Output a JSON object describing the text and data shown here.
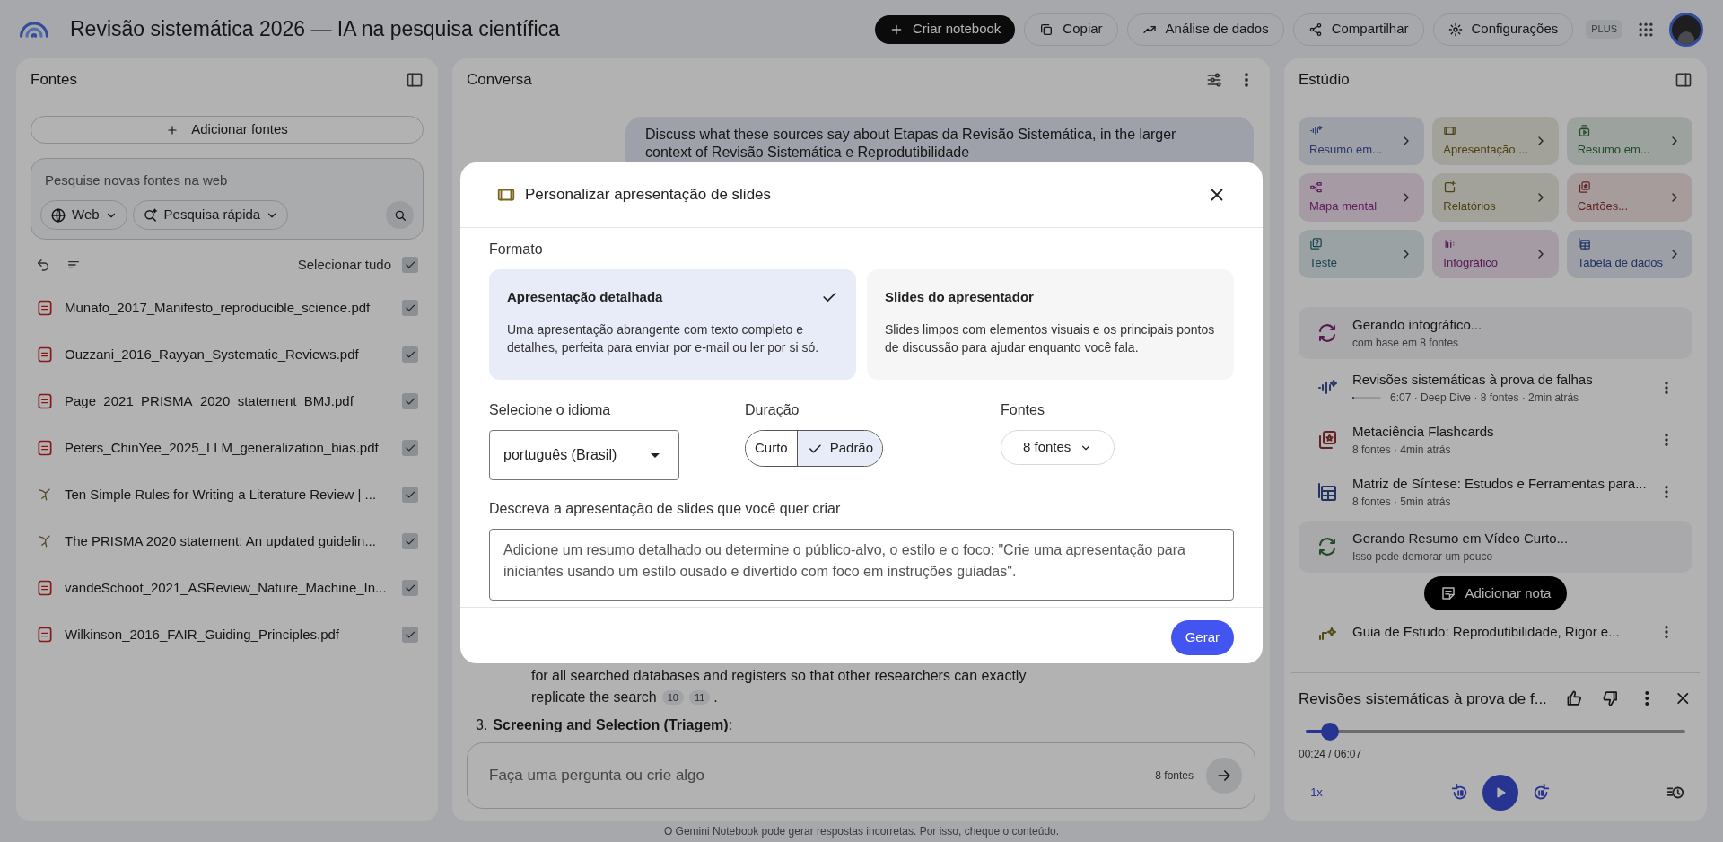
{
  "app": {
    "title": "Revisão sistemática 2026 — IA na pesquisa científica",
    "plan_badge": "PLUS"
  },
  "header_actions": [
    {
      "label": "Criar notebook",
      "kind": "primary"
    },
    {
      "label": "Copiar",
      "kind": "copy"
    },
    {
      "label": "Análise de dados",
      "kind": "analytics"
    },
    {
      "label": "Compartilhar",
      "kind": "share"
    },
    {
      "label": "Configurações",
      "kind": "settings"
    }
  ],
  "sources_panel": {
    "title": "Fontes",
    "add_button": "Adicionar fontes",
    "search": {
      "placeholder": "Pesquise novas fontes na web",
      "source_chip": "Web",
      "mode_chip": "Pesquisa rápida"
    },
    "select_all": {
      "label": "Selecionar tudo",
      "checked": true
    },
    "items": [
      {
        "name": "Munafo_2017_Manifesto_reproducible_science.pdf",
        "kind": "pdf",
        "checked": true
      },
      {
        "name": "Ouzzani_2016_Rayyan_Systematic_Reviews.pdf",
        "kind": "pdf",
        "checked": true
      },
      {
        "name": "Page_2021_PRISMA_2020_statement_BMJ.pdf",
        "kind": "pdf",
        "checked": true
      },
      {
        "name": "Peters_ChinYee_2025_LLM_generalization_bias.pdf",
        "kind": "pdf",
        "checked": true
      },
      {
        "name": "Ten Simple Rules for Writing a Literature Review | ...",
        "kind": "web",
        "checked": true
      },
      {
        "name": "The PRISMA 2020 statement: An updated guidelin...",
        "kind": "web",
        "checked": true
      },
      {
        "name": "vandeSchoot_2021_ASReview_Nature_Machine_In...",
        "kind": "pdf",
        "checked": true
      },
      {
        "name": "Wilkinson_2016_FAIR_Guiding_Principles.pdf",
        "kind": "pdf",
        "checked": true
      }
    ]
  },
  "chat_panel": {
    "title": "Conversa",
    "user_message": [
      "Discuss what these sources say about Etapas da Revisão Sistemática, in the larger",
      "context of Revisão Sistemática e Reprodutibilidade"
    ],
    "response_lines": [
      {
        "text": "for all searched databases and registers so that other researchers can exactly"
      },
      {
        "text": "replicate the search",
        "citations": [
          "10",
          "11"
        ],
        "tail": "."
      }
    ],
    "list_item": {
      "number": "3.",
      "text": "**Screening and Selection (Triagem)**:"
    },
    "input": {
      "placeholder": "Faça uma pergunta ou crie algo",
      "source_count": "8 fontes"
    }
  },
  "studio_panel": {
    "title": "Estúdio",
    "tiles": [
      {
        "label": "Resumo em...",
        "kind": "audio"
      },
      {
        "label": "Apresentação ...",
        "kind": "slides"
      },
      {
        "label": "Resumo em...",
        "kind": "video"
      },
      {
        "label": "Mapa mental",
        "kind": "mindmap"
      },
      {
        "label": "Relatórios",
        "kind": "reports"
      },
      {
        "label": "Cartões...",
        "kind": "flashcards"
      },
      {
        "label": "Teste",
        "kind": "quiz"
      },
      {
        "label": "Infográfico",
        "kind": "infographic"
      },
      {
        "label": "Tabela de dados",
        "kind": "table"
      }
    ],
    "items": [
      {
        "kind": "infographic_job",
        "title": "Gerando infográfico...",
        "subtitle": "com base em 8 fontes"
      },
      {
        "kind": "audio",
        "title": "Revisões sistemáticas à prova de falhas",
        "subtitle": "6:07 · Deep Dive · 8 fontes · 2min atrás",
        "level": 0.06
      },
      {
        "kind": "flashcards",
        "title": "Metaciência Flashcards",
        "subtitle": "8 fontes · 4min atrás"
      },
      {
        "kind": "table",
        "title": "Matriz de Síntese: Estudos e Ferramentas para...",
        "subtitle": "8 fontes · 5min atrás"
      },
      {
        "kind": "video_job",
        "title": "Gerando Resumo em Vídeo Curto...",
        "subtitle": "Isso pode demorar um pouco"
      },
      {
        "kind": "guide",
        "title": "Guia de Estudo: Reprodutibilidade, Rigor e..."
      }
    ],
    "add_note": "Adicionar nota",
    "player": {
      "title": "Revisões sistemáticas à prova de f...",
      "level": 0.065,
      "time": "00:24 / 06:07",
      "speed": "1x"
    }
  },
  "footer": "O Gemini Notebook pode gerar respostas incorretas. Por isso, cheque o conteúdo.",
  "dialog": {
    "title": "Personalizar apresentação de slides",
    "format_label": "Formato",
    "formats": [
      {
        "title": "Apresentação detalhada",
        "description": "Uma apresentação abrangente com texto completo e detalhes, perfeita para enviar por e-mail ou ler por si só.",
        "selected": true
      },
      {
        "title": "Slides do apresentador",
        "description": "Slides limpos com elementos visuais e os principais pontos de discussão para ajudar enquanto você fala.",
        "selected": false
      }
    ],
    "language": {
      "label": "Selecione o idioma",
      "value": "português (Brasil)"
    },
    "duration": {
      "label": "Duração",
      "options": [
        {
          "label": "Curto",
          "selected": false
        },
        {
          "label": "Padrão",
          "selected": true
        }
      ]
    },
    "sources": {
      "label": "Fontes",
      "value": "8 fontes"
    },
    "prompt": {
      "label": "Descreva a apresentação de slides que você quer criar",
      "placeholder": "Adicione um resumo detalhado ou determine o público-alvo, o estilo e o foco: \"Crie uma apresentação para iniciantes usando um estilo ousado e divertido com foco em instruções guiadas\"."
    },
    "submit": "Gerar"
  }
}
